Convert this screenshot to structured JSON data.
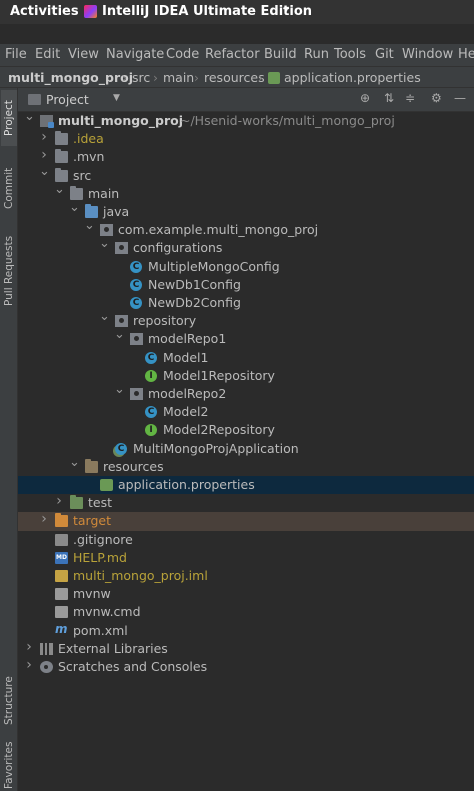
{
  "topbar": {
    "activities": "Activities",
    "app_title": "IntelliJ IDEA Ultimate Edition",
    "caret": "▾"
  },
  "menu": [
    "File",
    "Edit",
    "View",
    "Navigate",
    "Code",
    "Refactor",
    "Build",
    "Run",
    "Tools",
    "Git",
    "Window",
    "He"
  ],
  "breadcrumb": [
    "multi_mongo_proj",
    "src",
    "main",
    "resources",
    "application.properties"
  ],
  "side_tabs": {
    "project": "Project",
    "commit": "Commit",
    "pull_requests": "Pull Requests",
    "structure": "Structure",
    "favorites": "Favorites"
  },
  "project_panel": {
    "title": "Project",
    "toolbar": [
      "⊕",
      "⇅",
      "≑",
      "⚙",
      "—"
    ]
  },
  "tree": [
    {
      "label": "multi_mongo_proj",
      "hint": "~/Hsenid-works/multi_mongo_proj",
      "icon": "module-icon",
      "arrow": "down",
      "level": 0,
      "color": "#cccccc",
      "bold": true
    },
    {
      "label": ".idea",
      "icon": "folder-icon",
      "arrow": "right",
      "level": 1,
      "color": "#b8a239"
    },
    {
      "label": ".mvn",
      "icon": "folder-icon",
      "arrow": "right",
      "level": 1,
      "color": "#bbbbbb"
    },
    {
      "label": "src",
      "icon": "folder-icon",
      "arrow": "down",
      "level": 1,
      "color": "#bbbbbb"
    },
    {
      "label": "main",
      "icon": "folder-icon",
      "arrow": "down",
      "level": 2,
      "color": "#bbbbbb"
    },
    {
      "label": "java",
      "icon": "source-folder-icon",
      "arrow": "down",
      "level": 3,
      "color": "#bbbbbb"
    },
    {
      "label": "com.example.multi_mongo_proj",
      "icon": "package-icon",
      "arrow": "down",
      "level": 4,
      "color": "#bbbbbb"
    },
    {
      "label": "configurations",
      "icon": "package-icon",
      "arrow": "down",
      "level": 5,
      "color": "#bbbbbb"
    },
    {
      "label": "MultipleMongoConfig",
      "icon": "class-icon",
      "arrow": "none",
      "level": 6,
      "color": "#bbbbbb"
    },
    {
      "label": "NewDb1Config",
      "icon": "class-icon",
      "arrow": "none",
      "level": 6,
      "color": "#bbbbbb"
    },
    {
      "label": "NewDb2Config",
      "icon": "class-icon",
      "arrow": "none",
      "level": 6,
      "color": "#bbbbbb"
    },
    {
      "label": "repository",
      "icon": "package-icon",
      "arrow": "down",
      "level": 5,
      "color": "#bbbbbb"
    },
    {
      "label": "modelRepo1",
      "icon": "package-icon",
      "arrow": "down",
      "level": 6,
      "color": "#bbbbbb"
    },
    {
      "label": "Model1",
      "icon": "class-icon",
      "arrow": "none",
      "level": 7,
      "color": "#bbbbbb"
    },
    {
      "label": "Model1Repository",
      "icon": "interface-icon",
      "arrow": "none",
      "level": 7,
      "color": "#bbbbbb"
    },
    {
      "label": "modelRepo2",
      "icon": "package-icon",
      "arrow": "down",
      "level": 6,
      "color": "#bbbbbb"
    },
    {
      "label": "Model2",
      "icon": "class-icon",
      "arrow": "none",
      "level": 7,
      "color": "#bbbbbb"
    },
    {
      "label": "Model2Repository",
      "icon": "interface-icon",
      "arrow": "none",
      "level": 7,
      "color": "#bbbbbb"
    },
    {
      "label": "MultiMongoProjApplication",
      "icon": "spring-class-icon",
      "arrow": "none",
      "level": 5,
      "color": "#bbbbbb"
    },
    {
      "label": "resources",
      "icon": "resources-folder-icon",
      "arrow": "down",
      "level": 3,
      "color": "#bbbbbb"
    },
    {
      "label": "application.properties",
      "icon": "properties-file-icon",
      "arrow": "none",
      "level": 4,
      "color": "#bbbbbb",
      "selected": true
    },
    {
      "label": "test",
      "icon": "test-folder-icon",
      "arrow": "right",
      "level": 2,
      "color": "#bbbbbb"
    },
    {
      "label": "target",
      "icon": "excluded-folder-icon",
      "arrow": "right",
      "level": 1,
      "color": "#d18a3a",
      "excluded": true
    },
    {
      "label": ".gitignore",
      "icon": "gitignore-file-icon",
      "arrow": "none",
      "level": 1,
      "color": "#bbbbbb"
    },
    {
      "label": "HELP.md",
      "icon": "markdown-file-icon",
      "arrow": "none",
      "level": 1,
      "color": "#b8a239",
      "icon_text": "MD"
    },
    {
      "label": "multi_mongo_proj.iml",
      "icon": "iml-file-icon",
      "arrow": "none",
      "level": 1,
      "color": "#b8a239"
    },
    {
      "label": "mvnw",
      "icon": "file-icon",
      "arrow": "none",
      "level": 1,
      "color": "#bbbbbb"
    },
    {
      "label": "mvnw.cmd",
      "icon": "file-icon",
      "arrow": "none",
      "level": 1,
      "color": "#bbbbbb"
    },
    {
      "label": "pom.xml",
      "icon": "maven-icon",
      "arrow": "none",
      "level": 1,
      "color": "#bbbbbb",
      "icon_text": "m"
    },
    {
      "label": "External Libraries",
      "icon": "libraries-icon",
      "arrow": "right",
      "level": 0,
      "color": "#bbbbbb"
    },
    {
      "label": "Scratches and Consoles",
      "icon": "scratches-icon",
      "arrow": "right",
      "level": 0,
      "color": "#bbbbbb"
    }
  ]
}
